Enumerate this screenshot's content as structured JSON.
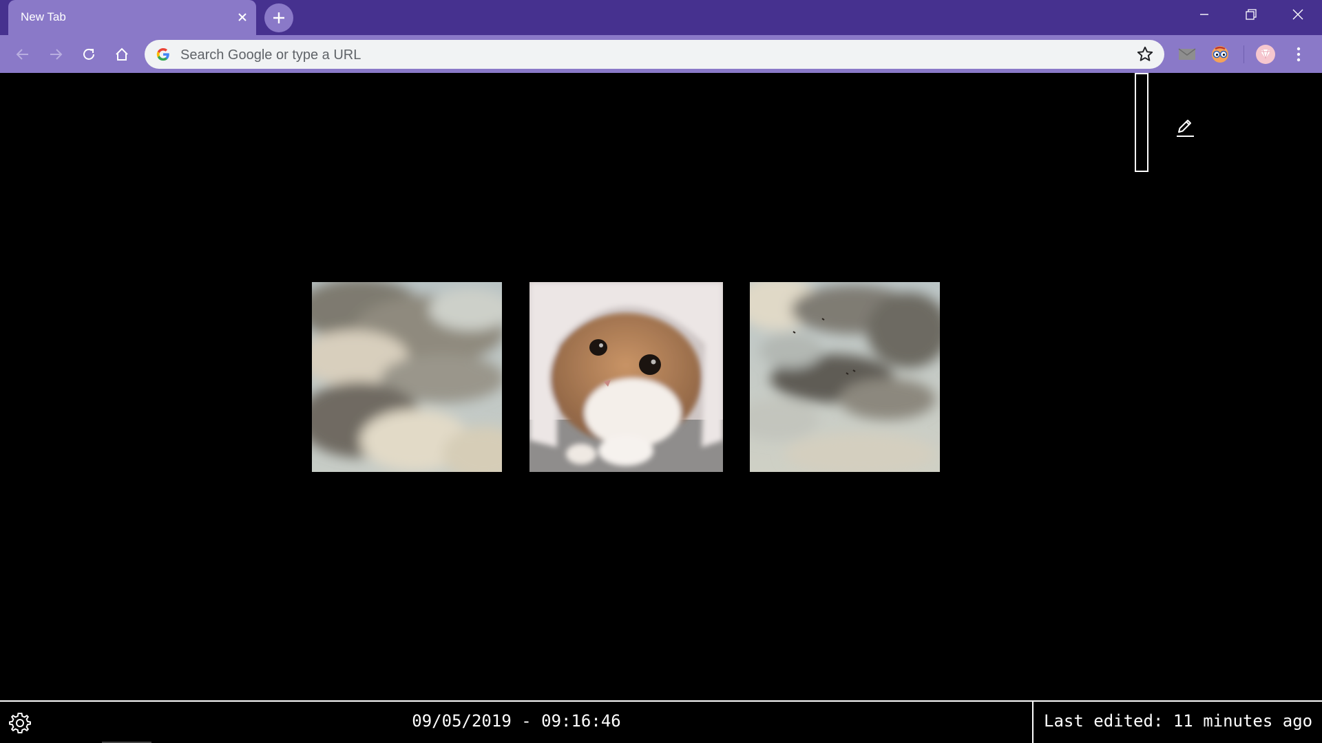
{
  "browser": {
    "tab": {
      "title": "New Tab",
      "close_icon": "close-icon"
    },
    "new_tab_icon": "plus-icon",
    "window_controls": [
      "minimize-icon",
      "restore-icon",
      "close-icon"
    ],
    "nav": [
      "back-arrow-icon",
      "forward-arrow-icon",
      "reload-icon",
      "home-icon"
    ],
    "omnibox": {
      "placeholder": "Search Google or type a URL",
      "value": ""
    },
    "extensions": [
      "mail-icon",
      "eyes-icon",
      "profile-avatar",
      "more-vert-icon"
    ],
    "colors": {
      "tabstrip": "#46318f",
      "toolbar": "#8a79c8"
    }
  },
  "page": {
    "edit_icon": "pencil-icon",
    "tiles": [
      {
        "name": "clouds-painting-left"
      },
      {
        "name": "cat-under-blanket"
      },
      {
        "name": "clouds-painting-right"
      }
    ],
    "footer": {
      "settings_icon": "gear-icon",
      "datetime": "09/05/2019 - 09:16:46",
      "last_edited": "Last edited: 11 minutes ago"
    }
  }
}
